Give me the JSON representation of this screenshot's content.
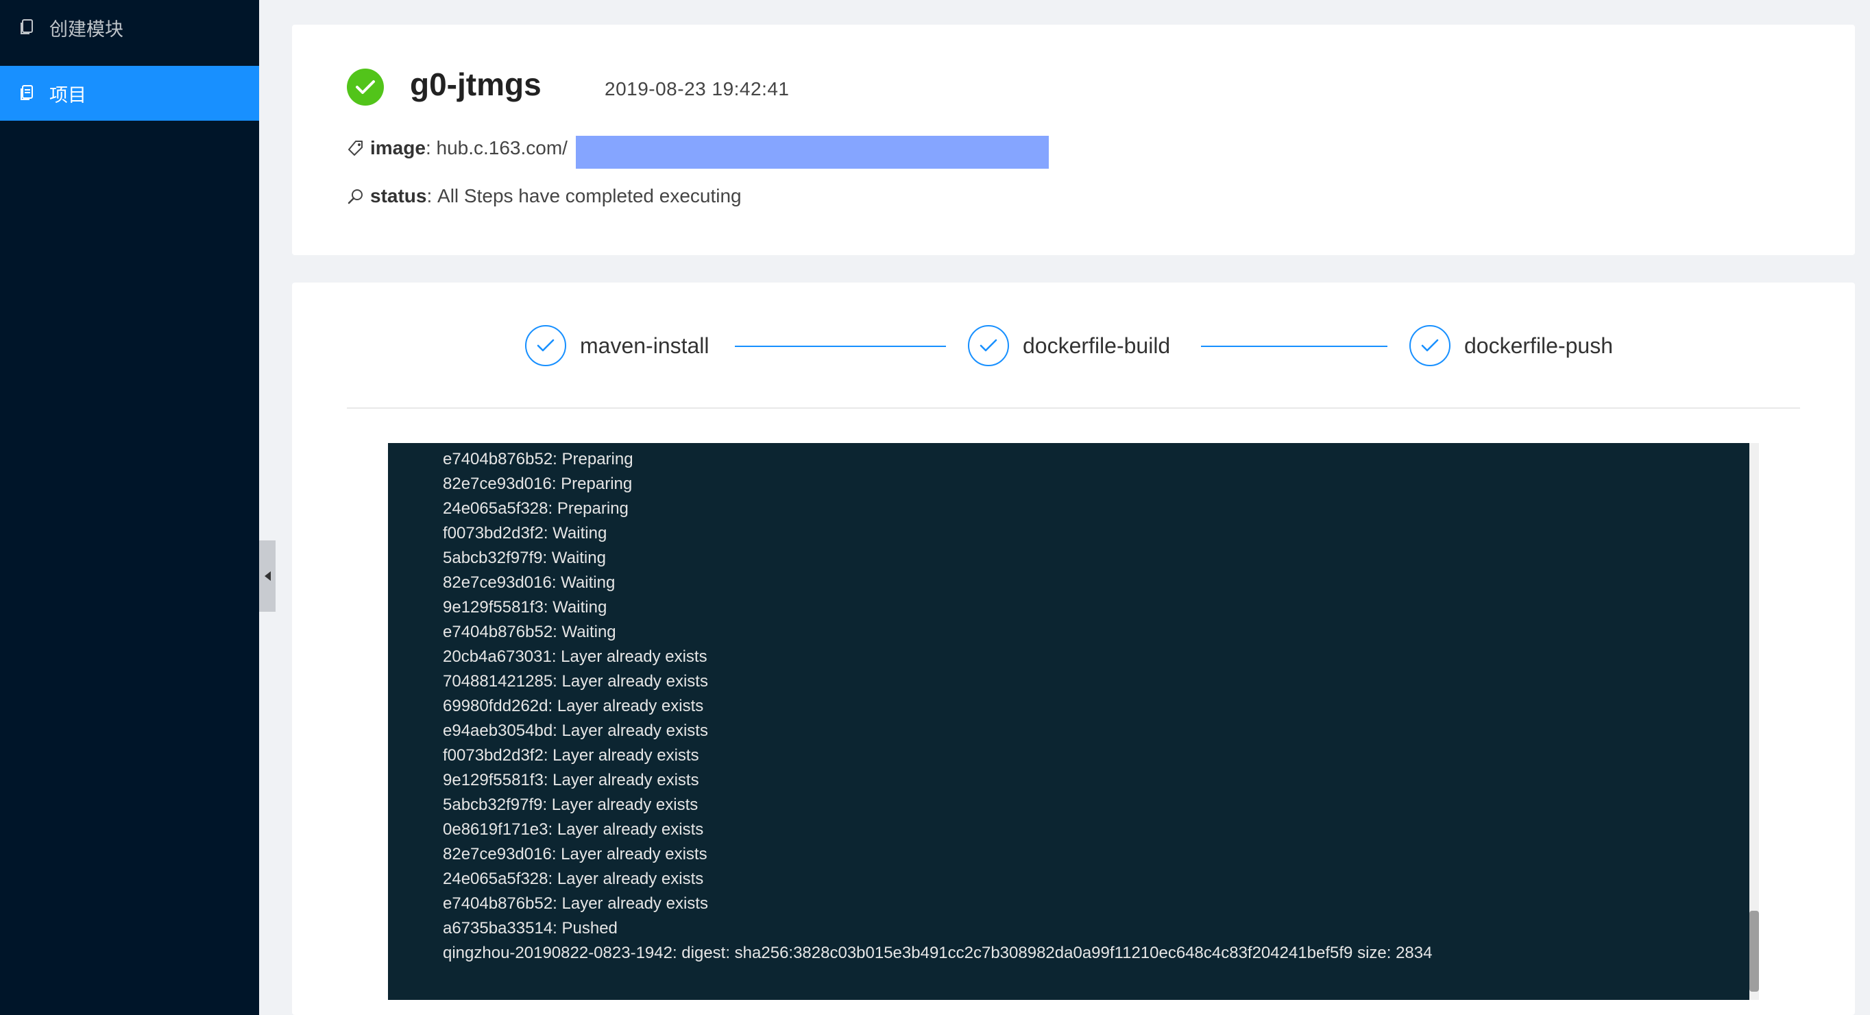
{
  "sidebar": {
    "items": [
      {
        "label": "创建模块",
        "icon": "file-copy-icon"
      },
      {
        "label": "项目",
        "icon": "file-copy-icon"
      }
    ]
  },
  "header": {
    "name": "g0-jtmgs",
    "timestamp": "2019-08-23 19:42:41",
    "image_label": "image",
    "image_value": "hub.c.163.com/",
    "status_label": "status",
    "status_value": "All Steps have completed executing"
  },
  "steps": [
    {
      "label": "maven-install"
    },
    {
      "label": "dockerfile-build"
    },
    {
      "label": "dockerfile-push"
    }
  ],
  "log": [
    "e7404b876b52: Preparing",
    "82e7ce93d016: Preparing",
    "24e065a5f328: Preparing",
    "f0073bd2d3f2: Waiting",
    "5abcb32f97f9: Waiting",
    "82e7ce93d016: Waiting",
    "9e129f5581f3: Waiting",
    "e7404b876b52: Waiting",
    "20cb4a673031: Layer already exists",
    "704881421285: Layer already exists",
    "69980fdd262d: Layer already exists",
    "e94aeb3054bd: Layer already exists",
    "f0073bd2d3f2: Layer already exists",
    "9e129f5581f3: Layer already exists",
    "5abcb32f97f9: Layer already exists",
    "0e8619f171e3: Layer already exists",
    "82e7ce93d016: Layer already exists",
    "24e065a5f328: Layer already exists",
    "e7404b876b52: Layer already exists",
    "a6735ba33514: Pushed",
    "qingzhou-20190822-0823-1942: digest: sha256:3828c03b015e3b491cc2c7b308982da0a99f11210ec648c4c83f204241bef5f9 size: 2834"
  ],
  "colors": {
    "sidebar_bg": "#001529",
    "accent": "#1890ff",
    "success": "#52c41a",
    "log_bg": "#0c2531"
  }
}
